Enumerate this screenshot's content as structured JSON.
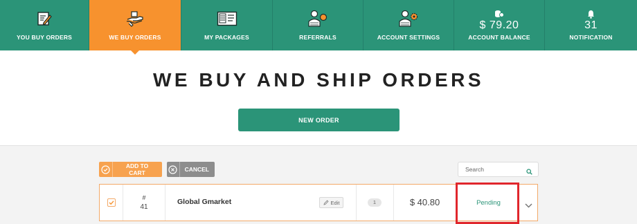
{
  "nav": {
    "items": [
      {
        "label": "YOU BUY ORDERS",
        "icon": "pencil-paper-icon"
      },
      {
        "label": "WE BUY ORDERS",
        "icon": "hand-box-icon"
      },
      {
        "label": "MY PACKAGES",
        "icon": "package-list-icon"
      },
      {
        "label": "REFERRALS",
        "icon": "referral-people-icon"
      },
      {
        "label": "ACCOUNT SETTINGS",
        "icon": "user-gear-icon"
      },
      {
        "label": "ACCOUNT BALANCE",
        "value": "$ 79.20",
        "icon": "coins-icon"
      },
      {
        "label": "NOTIFICATION",
        "value": "31",
        "icon": "bell-icon"
      }
    ],
    "active_index": 1
  },
  "hero": {
    "title": "WE BUY AND SHIP ORDERS",
    "new_order_label": "NEW ORDER"
  },
  "toolbar": {
    "add_to_cart_label": "ADD TO CART",
    "cancel_label": "CANCEL",
    "search_placeholder": "Search"
  },
  "order": {
    "hash": "#",
    "number": "41",
    "name": "Global Gmarket",
    "edit_label": "Edit",
    "quantity": "1",
    "price": "$ 40.80",
    "status": "Pending",
    "checked": true
  },
  "colors": {
    "primary_green": "#2b9478",
    "accent_orange": "#f7922e",
    "highlight_red": "#e0262c"
  }
}
